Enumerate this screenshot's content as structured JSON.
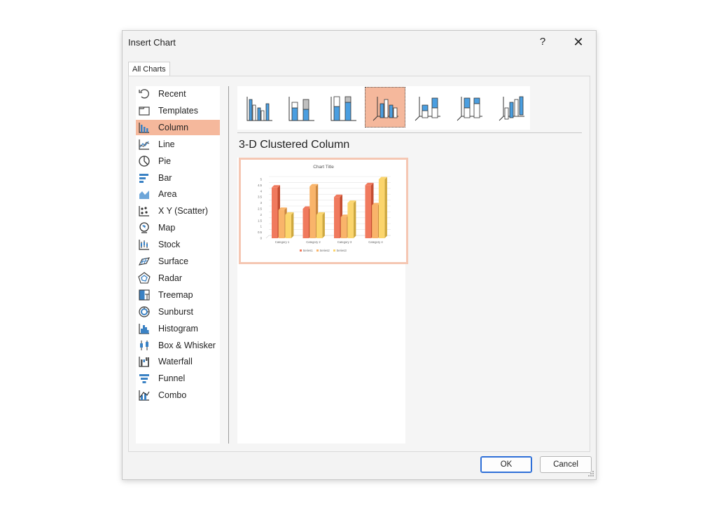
{
  "dialog": {
    "title": "Insert Chart",
    "help_label": "?",
    "close_label": "✕",
    "tab_label": "All Charts",
    "ok_label": "OK",
    "cancel_label": "Cancel"
  },
  "chart_types": [
    {
      "label": "Recent",
      "icon": "recent-icon"
    },
    {
      "label": "Templates",
      "icon": "templates-icon"
    },
    {
      "label": "Column",
      "icon": "column-chart-icon",
      "selected": true
    },
    {
      "label": "Line",
      "icon": "line-chart-icon"
    },
    {
      "label": "Pie",
      "icon": "pie-chart-icon"
    },
    {
      "label": "Bar",
      "icon": "bar-chart-icon"
    },
    {
      "label": "Area",
      "icon": "area-chart-icon"
    },
    {
      "label": "X Y (Scatter)",
      "icon": "scatter-chart-icon"
    },
    {
      "label": "Map",
      "icon": "map-chart-icon"
    },
    {
      "label": "Stock",
      "icon": "stock-chart-icon"
    },
    {
      "label": "Surface",
      "icon": "surface-chart-icon"
    },
    {
      "label": "Radar",
      "icon": "radar-chart-icon"
    },
    {
      "label": "Treemap",
      "icon": "treemap-chart-icon"
    },
    {
      "label": "Sunburst",
      "icon": "sunburst-chart-icon"
    },
    {
      "label": "Histogram",
      "icon": "histogram-chart-icon"
    },
    {
      "label": "Box & Whisker",
      "icon": "box-whisker-chart-icon"
    },
    {
      "label": "Waterfall",
      "icon": "waterfall-chart-icon"
    },
    {
      "label": "Funnel",
      "icon": "funnel-chart-icon"
    },
    {
      "label": "Combo",
      "icon": "combo-chart-icon"
    }
  ],
  "subtypes": [
    {
      "icon": "clustered-column-icon"
    },
    {
      "icon": "stacked-column-icon"
    },
    {
      "icon": "100-stacked-column-icon"
    },
    {
      "icon": "3d-clustered-column-icon",
      "selected": true
    },
    {
      "icon": "3d-stacked-column-icon"
    },
    {
      "icon": "3d-100-stacked-column-icon"
    },
    {
      "icon": "3d-column-icon"
    }
  ],
  "selected_subtype_label": "3-D Clustered Column",
  "colors": {
    "selection": "#f5b89c",
    "series1": "#f07a5e",
    "series2": "#f9b46a",
    "series3": "#fbd56c"
  },
  "chart_data": {
    "type": "bar",
    "title": "Chart Title",
    "categories": [
      "Category 1",
      "Category 2",
      "Category 3",
      "Category 4"
    ],
    "series": [
      {
        "name": "Series1",
        "values": [
          4.3,
          2.5,
          3.5,
          4.5
        ]
      },
      {
        "name": "Series2",
        "values": [
          2.4,
          4.4,
          1.8,
          2.8
        ]
      },
      {
        "name": "Series3",
        "values": [
          2.0,
          2.0,
          3.0,
          5.0
        ]
      }
    ],
    "yticks": [
      "0",
      "0.5",
      "1",
      "1.5",
      "2",
      "2.5",
      "3",
      "3.5",
      "4",
      "4.5",
      "5"
    ],
    "ylim": [
      0,
      5
    ],
    "grid": true,
    "legend": "bottom"
  }
}
